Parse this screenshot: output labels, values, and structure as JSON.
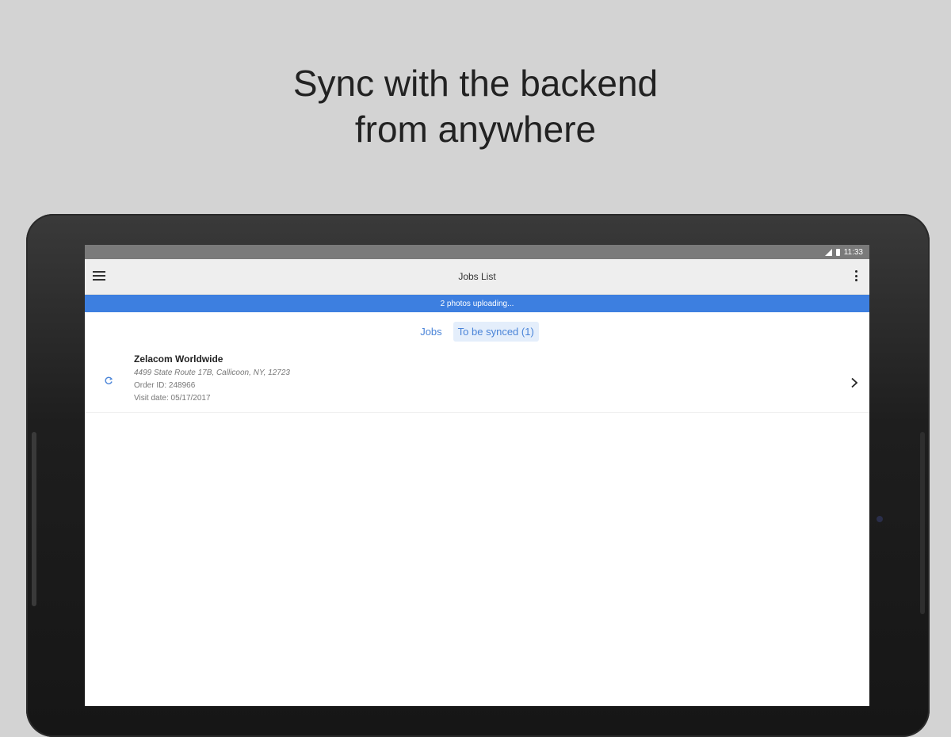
{
  "headline": {
    "line1": "Sync with the backend",
    "line2": "from anywhere"
  },
  "statusbar": {
    "time": "11:33",
    "icons": [
      "signal-icon",
      "battery-icon"
    ]
  },
  "appbar": {
    "title": "Jobs List",
    "menu_icon": "hamburger-menu-icon",
    "overflow_icon": "more-vert-icon"
  },
  "upload_banner": {
    "text": "2 photos uploading..."
  },
  "tabs": [
    {
      "label": "Jobs",
      "active": false
    },
    {
      "label": "To be synced (1)",
      "active": true
    }
  ],
  "jobs": [
    {
      "name": "Zelacom Worldwide",
      "address": "4499 State Route 17B, Callicoon, NY, 12723",
      "order_id": "Order ID: 248966",
      "visit_date": "Visit date: 05/17/2017",
      "status_icon": "sync-icon"
    }
  ],
  "colors": {
    "accent": "#3d7fe0",
    "tab_text": "#4a84d8",
    "background": "#d3d3d3"
  }
}
